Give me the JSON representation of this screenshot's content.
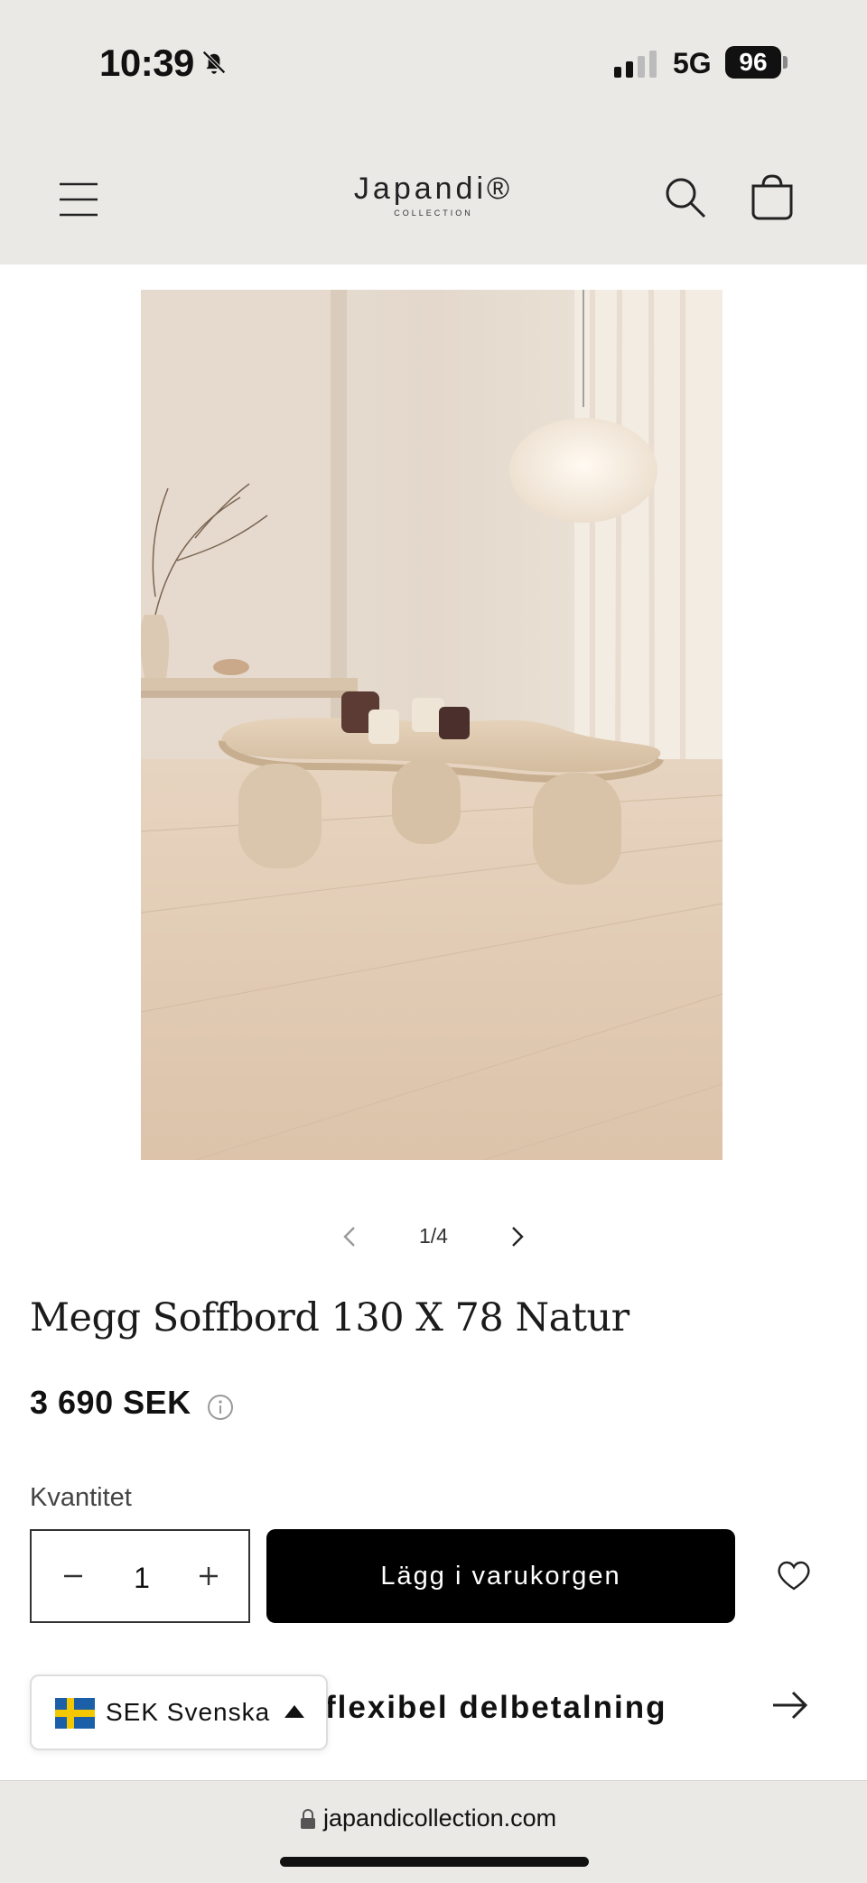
{
  "status_bar": {
    "time": "10:39",
    "network": "5G",
    "battery": "96"
  },
  "header": {
    "logo_main": "Japandi®",
    "logo_sub": "COLLECTION",
    "icons": [
      "menu-icon",
      "search-icon",
      "cart-icon"
    ]
  },
  "gallery": {
    "counter": "1/4",
    "current": 1,
    "total": 4
  },
  "product": {
    "title": "Megg Soffbord 130 X 78 Natur",
    "price": "3 690 SEK"
  },
  "quantity": {
    "label": "Kvantitet",
    "value": "1"
  },
  "actions": {
    "add_to_cart": "Lägg i varukorgen",
    "installment": "flexibel delbetalning"
  },
  "locale": {
    "text": "SEK Svenska"
  },
  "browser": {
    "url": "japandicollection.com"
  },
  "colors": {
    "header_bg": "#ebe9e6",
    "button_bg": "#000000",
    "button_text": "#ffffff"
  }
}
